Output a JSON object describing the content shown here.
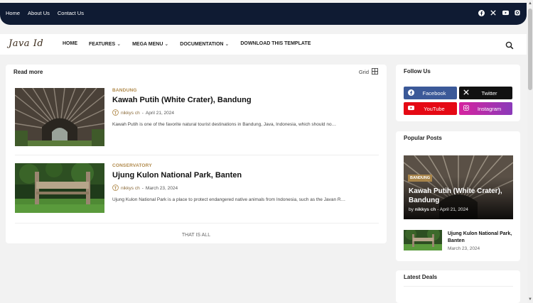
{
  "topbar": {
    "links": [
      "Home",
      "About Us",
      "Contact Us"
    ],
    "social_icons": [
      "facebook-icon",
      "x-icon",
      "youtube-icon",
      "instagram-icon"
    ]
  },
  "header": {
    "logo": "Java Id",
    "nav": {
      "home": "HOME",
      "features": "FEATURES",
      "mega_menu": "MEGA MENU",
      "documentation": "DOCUMENTATION",
      "download": "DOWNLOAD THIS TEMPLATE"
    },
    "chevron": "⌄"
  },
  "main": {
    "heading": "Read more",
    "view_toggle": "Grid",
    "posts": [
      {
        "category": "BANDUNG",
        "title": "Kawah Putih (White Crater), Bandung",
        "author": "nikkys ch",
        "date": "April 21, 2024",
        "excerpt": "Kawah Putih is one of the favorite natural tourist destinations in Bandung, Java, Indonesia, which should no…"
      },
      {
        "category": "CONSERVATORY",
        "title": "Ujung Kulon National Park, Banten",
        "author": "nikkys ch",
        "date": "March 23, 2024",
        "excerpt": "Ujung Kulon National Park is a place to protect endangered native animals from Indonesia, such as the Javan R…"
      }
    ],
    "end_note": "THAT IS ALL"
  },
  "sidebar": {
    "follow_us": {
      "title": "Follow Us",
      "buttons": [
        {
          "label": "Facebook",
          "color": "#3b5998"
        },
        {
          "label": "Twitter",
          "color": "#111111"
        },
        {
          "label": "YouTube",
          "color": "#e50914"
        },
        {
          "label": "Instagram",
          "color": "#c13584"
        }
      ]
    },
    "popular_posts": {
      "title": "Popular Posts",
      "featured": {
        "category": "BANDUNG",
        "title": "Kawah Putih (White Crater), Bandung",
        "by_prefix": "by",
        "author": "nikkys ch",
        "separator": "-",
        "date": "April 21, 2024"
      },
      "small": {
        "title": "Ujung Kulon National Park, Banten",
        "date": "March 23, 2024"
      }
    },
    "latest_deals": {
      "title": "Latest Deals"
    }
  },
  "colors": {
    "topbar_bg": "#0f1b33",
    "accent": "#b0894a"
  }
}
